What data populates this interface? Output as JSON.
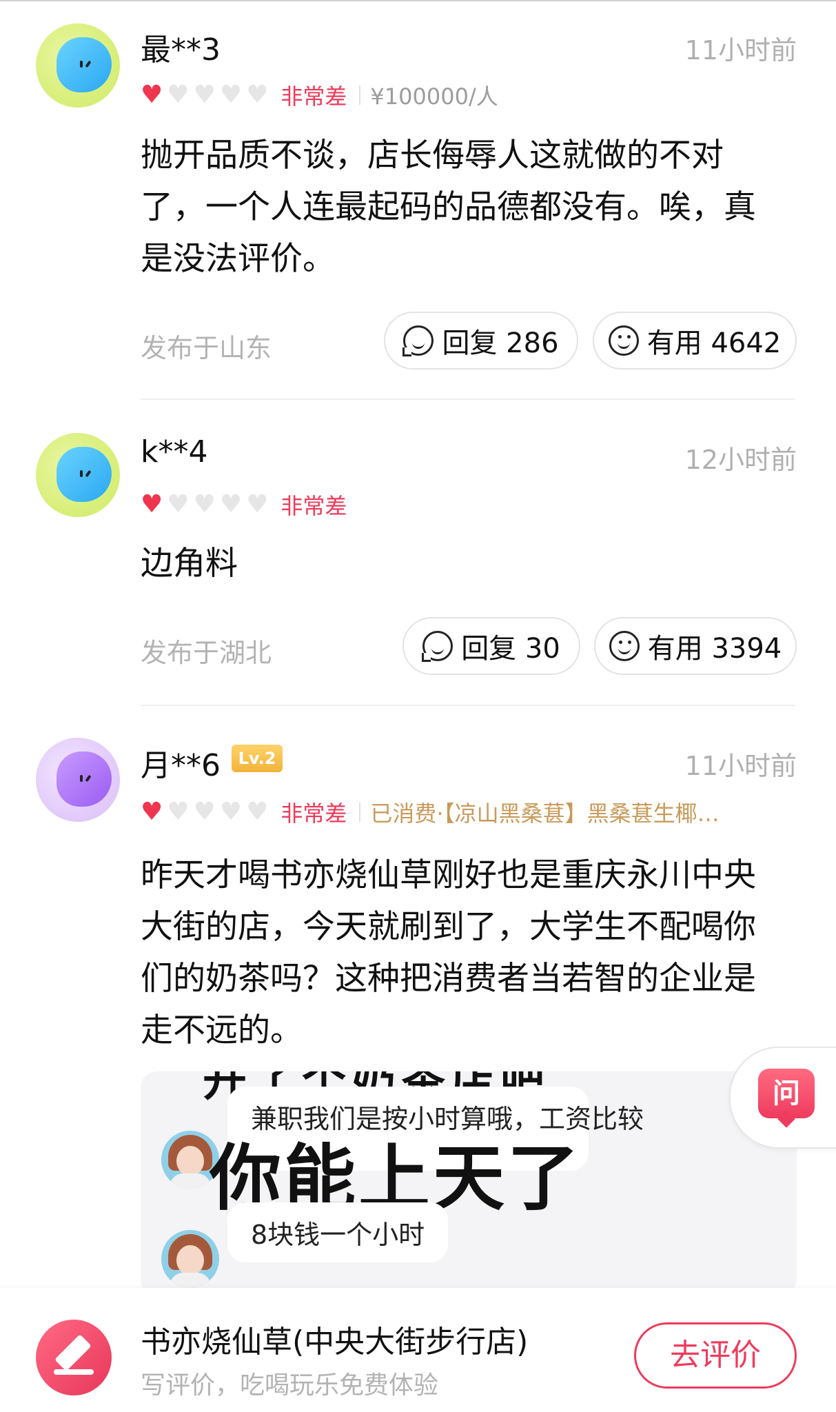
{
  "reviews": [
    {
      "username": "最**3",
      "time": "11小时前",
      "hearts_filled": 1,
      "hearts_total": 5,
      "rating_label": "非常差",
      "price": "¥100000/人",
      "text": "抛开品质不谈，店长侮辱人这就做的不对了，一个人连最起码的品德都没有。唉，真是没法评价。",
      "location": "发布于山东",
      "reply_label": "回复 286",
      "useful_label": "有用 4642"
    },
    {
      "username": "k**4",
      "time": "12小时前",
      "hearts_filled": 1,
      "hearts_total": 5,
      "rating_label": "非常差",
      "text": "边角料",
      "location": "发布于湖北",
      "reply_label": "回复 30",
      "useful_label": "有用 3394"
    },
    {
      "username": "月**6",
      "level": "Lv.2",
      "time": "11小时前",
      "hearts_filled": 1,
      "hearts_total": 5,
      "rating_label": "非常差",
      "consumed": "已消费·【凉山黑桑葚】黑桑葚生椰…",
      "text": "昨天才喝书亦烧仙草刚好也是重庆永川中央大街的店，今天就刷到了，大学生不配喝你们的奶茶吗？这种把消费者当若智的企业是走不远的。",
      "video": {
        "top_text": "开了个奶茶店吧",
        "bubble1": "兼职我们是按小时算哦，工资比较",
        "overlay": "你能上天了",
        "bubble2": "8块钱一个小时"
      }
    }
  ],
  "ask_button": {
    "label": "问"
  },
  "bottom_bar": {
    "store_name": "书亦烧仙草(中央大街步行店)",
    "subtitle": "写评价，吃喝玩乐免费体验",
    "review_button": "去评价"
  },
  "colors": {
    "accent": "#ee3b5b",
    "heart": "#f0354e",
    "gold": "#c89a5a"
  }
}
